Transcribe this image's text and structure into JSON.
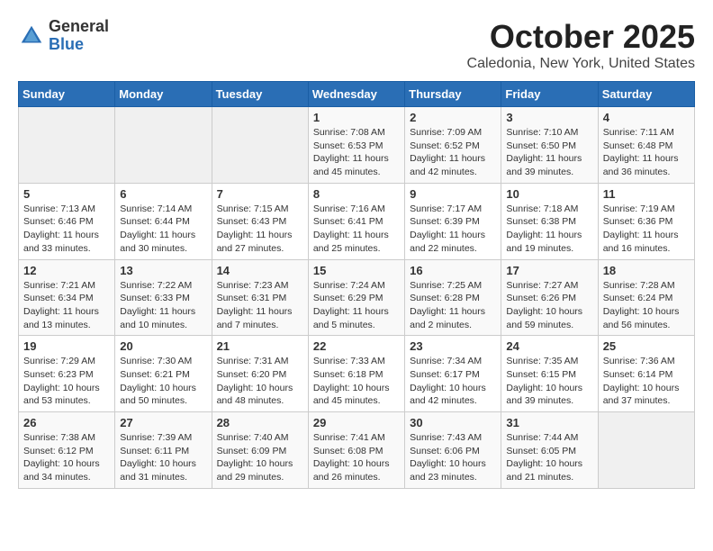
{
  "header": {
    "logo_general": "General",
    "logo_blue": "Blue",
    "month_title": "October 2025",
    "location": "Caledonia, New York, United States"
  },
  "weekdays": [
    "Sunday",
    "Monday",
    "Tuesday",
    "Wednesday",
    "Thursday",
    "Friday",
    "Saturday"
  ],
  "weeks": [
    [
      {
        "day": null,
        "info": null
      },
      {
        "day": null,
        "info": null
      },
      {
        "day": null,
        "info": null
      },
      {
        "day": "1",
        "info": "Sunrise: 7:08 AM\nSunset: 6:53 PM\nDaylight: 11 hours and 45 minutes."
      },
      {
        "day": "2",
        "info": "Sunrise: 7:09 AM\nSunset: 6:52 PM\nDaylight: 11 hours and 42 minutes."
      },
      {
        "day": "3",
        "info": "Sunrise: 7:10 AM\nSunset: 6:50 PM\nDaylight: 11 hours and 39 minutes."
      },
      {
        "day": "4",
        "info": "Sunrise: 7:11 AM\nSunset: 6:48 PM\nDaylight: 11 hours and 36 minutes."
      }
    ],
    [
      {
        "day": "5",
        "info": "Sunrise: 7:13 AM\nSunset: 6:46 PM\nDaylight: 11 hours and 33 minutes."
      },
      {
        "day": "6",
        "info": "Sunrise: 7:14 AM\nSunset: 6:44 PM\nDaylight: 11 hours and 30 minutes."
      },
      {
        "day": "7",
        "info": "Sunrise: 7:15 AM\nSunset: 6:43 PM\nDaylight: 11 hours and 27 minutes."
      },
      {
        "day": "8",
        "info": "Sunrise: 7:16 AM\nSunset: 6:41 PM\nDaylight: 11 hours and 25 minutes."
      },
      {
        "day": "9",
        "info": "Sunrise: 7:17 AM\nSunset: 6:39 PM\nDaylight: 11 hours and 22 minutes."
      },
      {
        "day": "10",
        "info": "Sunrise: 7:18 AM\nSunset: 6:38 PM\nDaylight: 11 hours and 19 minutes."
      },
      {
        "day": "11",
        "info": "Sunrise: 7:19 AM\nSunset: 6:36 PM\nDaylight: 11 hours and 16 minutes."
      }
    ],
    [
      {
        "day": "12",
        "info": "Sunrise: 7:21 AM\nSunset: 6:34 PM\nDaylight: 11 hours and 13 minutes."
      },
      {
        "day": "13",
        "info": "Sunrise: 7:22 AM\nSunset: 6:33 PM\nDaylight: 11 hours and 10 minutes."
      },
      {
        "day": "14",
        "info": "Sunrise: 7:23 AM\nSunset: 6:31 PM\nDaylight: 11 hours and 7 minutes."
      },
      {
        "day": "15",
        "info": "Sunrise: 7:24 AM\nSunset: 6:29 PM\nDaylight: 11 hours and 5 minutes."
      },
      {
        "day": "16",
        "info": "Sunrise: 7:25 AM\nSunset: 6:28 PM\nDaylight: 11 hours and 2 minutes."
      },
      {
        "day": "17",
        "info": "Sunrise: 7:27 AM\nSunset: 6:26 PM\nDaylight: 10 hours and 59 minutes."
      },
      {
        "day": "18",
        "info": "Sunrise: 7:28 AM\nSunset: 6:24 PM\nDaylight: 10 hours and 56 minutes."
      }
    ],
    [
      {
        "day": "19",
        "info": "Sunrise: 7:29 AM\nSunset: 6:23 PM\nDaylight: 10 hours and 53 minutes."
      },
      {
        "day": "20",
        "info": "Sunrise: 7:30 AM\nSunset: 6:21 PM\nDaylight: 10 hours and 50 minutes."
      },
      {
        "day": "21",
        "info": "Sunrise: 7:31 AM\nSunset: 6:20 PM\nDaylight: 10 hours and 48 minutes."
      },
      {
        "day": "22",
        "info": "Sunrise: 7:33 AM\nSunset: 6:18 PM\nDaylight: 10 hours and 45 minutes."
      },
      {
        "day": "23",
        "info": "Sunrise: 7:34 AM\nSunset: 6:17 PM\nDaylight: 10 hours and 42 minutes."
      },
      {
        "day": "24",
        "info": "Sunrise: 7:35 AM\nSunset: 6:15 PM\nDaylight: 10 hours and 39 minutes."
      },
      {
        "day": "25",
        "info": "Sunrise: 7:36 AM\nSunset: 6:14 PM\nDaylight: 10 hours and 37 minutes."
      }
    ],
    [
      {
        "day": "26",
        "info": "Sunrise: 7:38 AM\nSunset: 6:12 PM\nDaylight: 10 hours and 34 minutes."
      },
      {
        "day": "27",
        "info": "Sunrise: 7:39 AM\nSunset: 6:11 PM\nDaylight: 10 hours and 31 minutes."
      },
      {
        "day": "28",
        "info": "Sunrise: 7:40 AM\nSunset: 6:09 PM\nDaylight: 10 hours and 29 minutes."
      },
      {
        "day": "29",
        "info": "Sunrise: 7:41 AM\nSunset: 6:08 PM\nDaylight: 10 hours and 26 minutes."
      },
      {
        "day": "30",
        "info": "Sunrise: 7:43 AM\nSunset: 6:06 PM\nDaylight: 10 hours and 23 minutes."
      },
      {
        "day": "31",
        "info": "Sunrise: 7:44 AM\nSunset: 6:05 PM\nDaylight: 10 hours and 21 minutes."
      },
      {
        "day": null,
        "info": null
      }
    ]
  ]
}
